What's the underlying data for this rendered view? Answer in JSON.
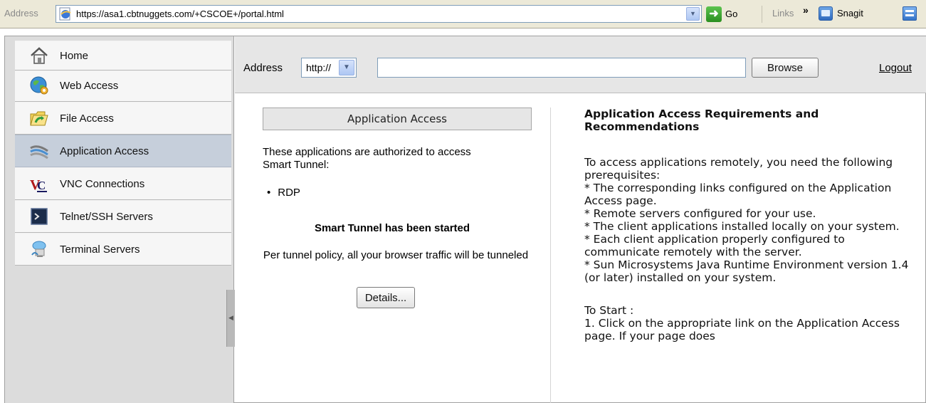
{
  "browser": {
    "address_label": "Address",
    "url": "https://asa1.cbtnuggets.com/+CSCOE+/portal.html",
    "go_label": "Go",
    "links_label": "Links",
    "chevron": "»",
    "snagit_label": "Snagit"
  },
  "sidebar": {
    "items": [
      {
        "label": "Home",
        "icon": "home-icon"
      },
      {
        "label": "Web Access",
        "icon": "globe-icon"
      },
      {
        "label": "File Access",
        "icon": "folder-icon"
      },
      {
        "label": "Application Access",
        "icon": "network-cable-icon"
      },
      {
        "label": "VNC Connections",
        "icon": "vnc-icon"
      },
      {
        "label": "Telnet/SSH Servers",
        "icon": "terminal-icon"
      },
      {
        "label": "Terminal Servers",
        "icon": "terminal-server-icon"
      }
    ],
    "active_index": 3
  },
  "toolbar": {
    "address_label": "Address",
    "protocol_value": "http://",
    "url_value": "",
    "browse_label": "Browse",
    "logout_label": "Logout"
  },
  "app_access": {
    "heading": "Application Access",
    "intro": "These applications are authorized to access Smart Tunnel:",
    "apps": [
      "RDP"
    ],
    "status": "Smart Tunnel has been started",
    "policy": "Per tunnel policy, all your browser traffic will be tunneled",
    "details_label": "Details..."
  },
  "requirements": {
    "title": "Application Access Requirements and Recommendations",
    "lines": [
      "To access applications remotely, you need the following prerequisites:",
      "* The corresponding links configured on the Application Access page.",
      "* Remote servers configured for your use.",
      "* The client applications installed locally on your system.",
      "* Each client application properly configured to communicate remotely with the server.",
      "* Sun Microsystems Java Runtime Environment version 1.4 (or later) installed on your system."
    ],
    "start_title": "To Start :",
    "start_lines": [
      "1. Click on the appropriate link on the Application Access page. If your page does"
    ]
  },
  "colors": {
    "sidebar_bg": "#dcdcdc",
    "active_item": "#c6cfdb",
    "toolbar_bg": "#e6e6e6",
    "chrome_bg": "#ece9d8"
  }
}
